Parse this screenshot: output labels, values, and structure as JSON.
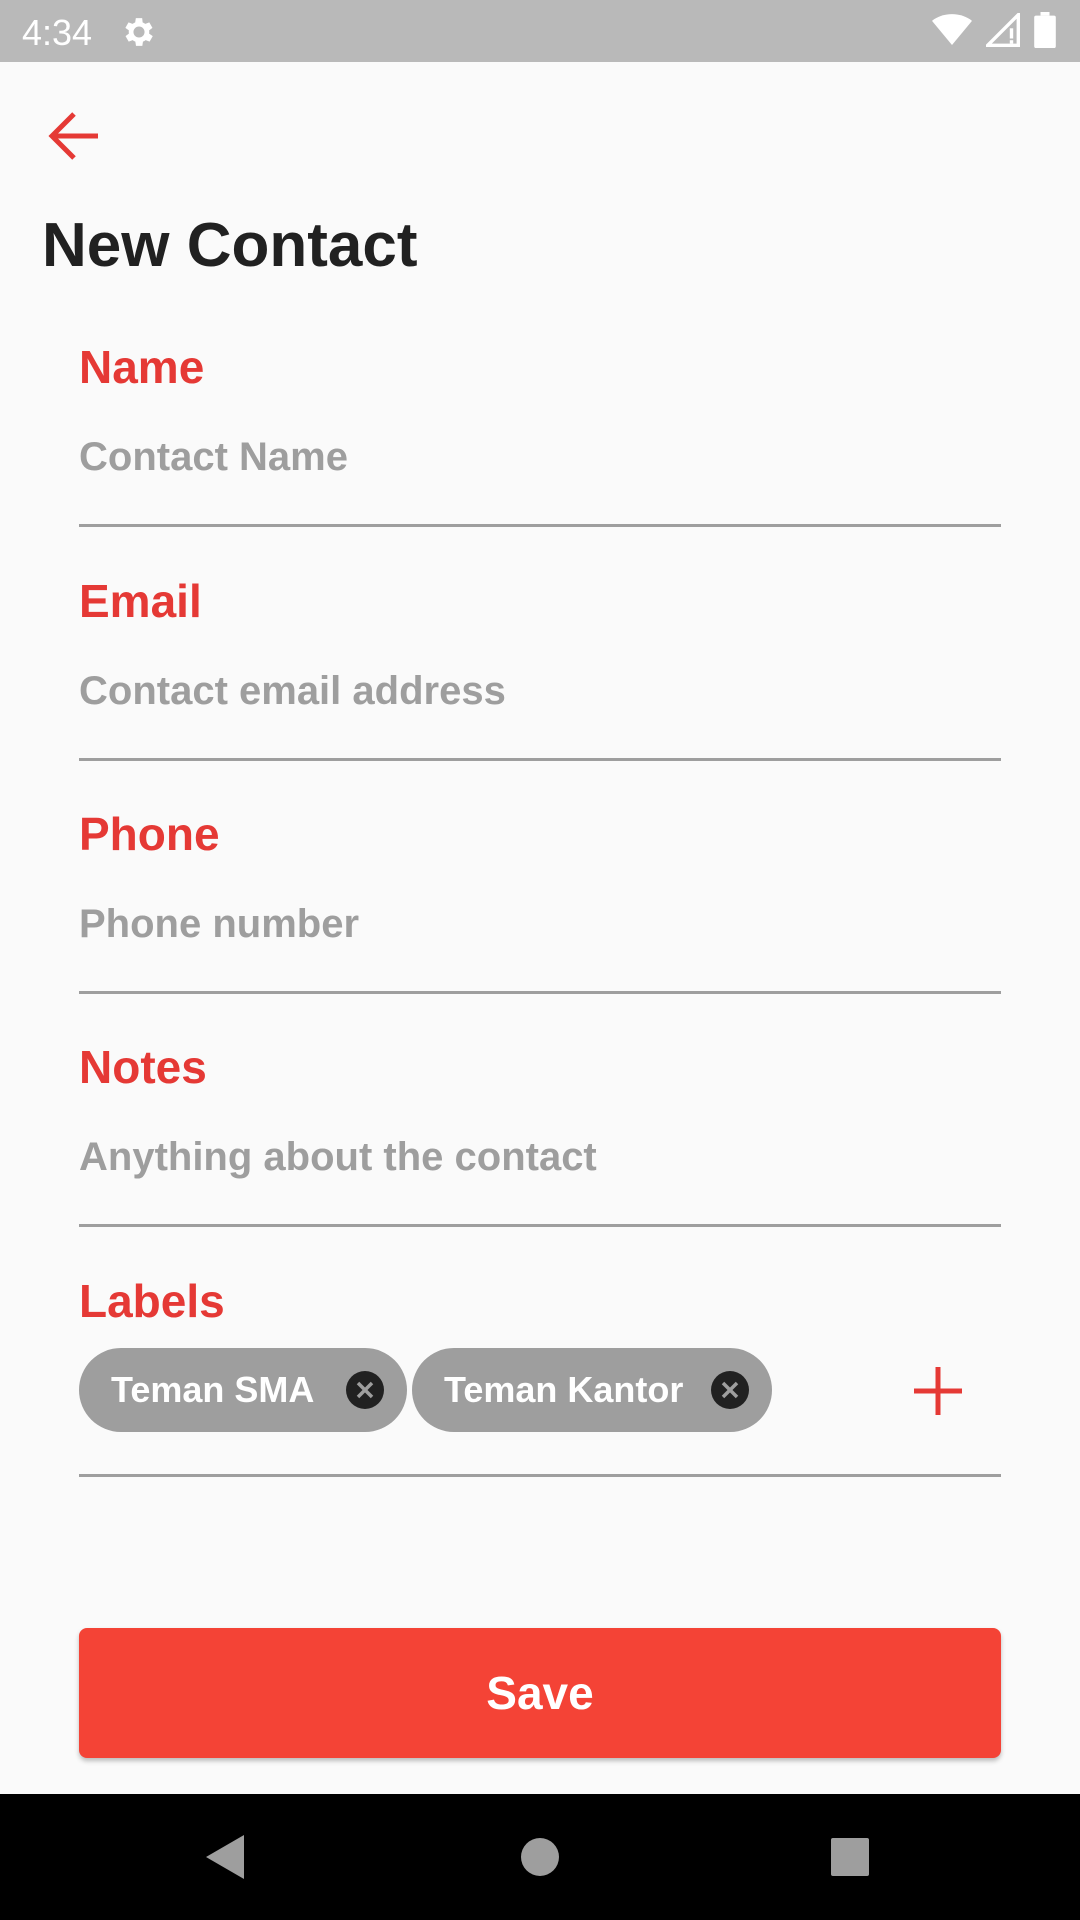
{
  "status_bar": {
    "time": "4:34",
    "settings_icon": "gear-icon",
    "wifi_icon": "wifi-icon",
    "signal_icon": "cell-signal-icon",
    "battery_icon": "battery-icon"
  },
  "header": {
    "back_icon": "arrow-back-icon",
    "title": "New Contact"
  },
  "form": {
    "name": {
      "label": "Name",
      "placeholder": "Contact Name",
      "value": ""
    },
    "email": {
      "label": "Email",
      "placeholder": "Contact email address",
      "value": ""
    },
    "phone": {
      "label": "Phone",
      "placeholder": "Phone number",
      "value": ""
    },
    "notes": {
      "label": "Notes",
      "placeholder": "Anything about the contact",
      "value": ""
    },
    "labels": {
      "label": "Labels",
      "chips": [
        {
          "text": "Teman SMA"
        },
        {
          "text": "Teman Kantor"
        }
      ],
      "add_icon": "plus-icon"
    }
  },
  "save_button": {
    "label": "Save"
  },
  "nav_bar": {
    "back_icon": "nav-back-icon",
    "home_icon": "nav-home-icon",
    "recents_icon": "nav-recents-icon"
  },
  "colors": {
    "accent": "#e53935",
    "button": "#f44336",
    "chip": "#9e9e9e",
    "status_bar": "#b9b9b9"
  }
}
